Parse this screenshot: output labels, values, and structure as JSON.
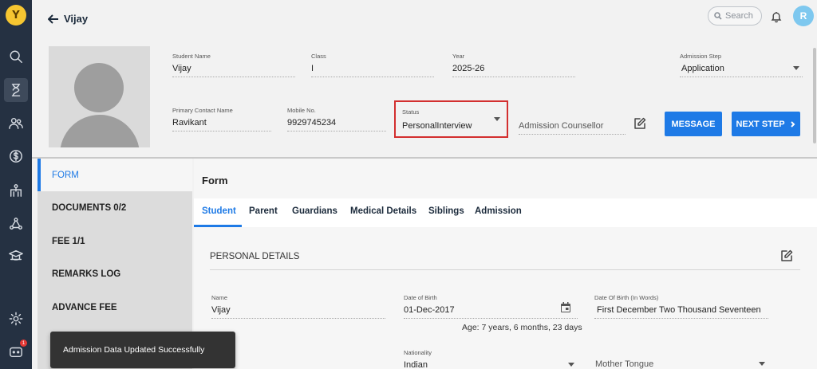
{
  "app": {
    "logo_letter": "Y"
  },
  "header": {
    "back_title": "Vijay",
    "search_placeholder": "Search",
    "avatar_initial": "R"
  },
  "student": {
    "student_name_label": "Student Name",
    "student_name": "Vijay",
    "class_label": "Class",
    "class_value": "I",
    "year_label": "Year",
    "year_value": "2025-26",
    "admission_step_label": "Admission Step",
    "admission_step_value": "Application",
    "primary_contact_label": "Primary Contact Name",
    "primary_contact_value": "Ravikant",
    "mobile_label": "Mobile No.",
    "mobile_value": "9929745234",
    "status_label": "Status",
    "status_value": "PersonalInterview",
    "counsellor_placeholder": "Admission Counsellor",
    "message_button": "MESSAGE",
    "next_step_button": "NEXT STEP"
  },
  "left_nav": {
    "items": [
      {
        "label": "FORM"
      },
      {
        "label": "DOCUMENTS 0/2"
      },
      {
        "label": "FEE 1/1"
      },
      {
        "label": "REMARKS LOG"
      },
      {
        "label": "ADVANCE FEE"
      }
    ]
  },
  "form": {
    "title": "Form",
    "tabs": [
      {
        "label": "Student"
      },
      {
        "label": "Parent"
      },
      {
        "label": "Guardians"
      },
      {
        "label": "Medical Details"
      },
      {
        "label": "Siblings"
      },
      {
        "label": "Admission"
      }
    ],
    "section_title": "PERSONAL DETAILS",
    "name_label": "Name",
    "name_value": "Vijay",
    "dob_label": "Date of Birth",
    "dob_value": "01-Dec-2017",
    "dob_words_label": "Date Of Birth (In Words)",
    "dob_words_value": "First December  Two Thousand Seventeen",
    "age_text": "Age: 7 years, 6 months, 23 days",
    "nationality_label": "Nationality",
    "nationality_value": "Indian",
    "mother_tongue_placeholder": "Mother Tongue"
  },
  "toast": {
    "message": "Admission Data Updated Successfully"
  },
  "colors": {
    "rail": "#253142",
    "accent": "#1e7ae6",
    "highlight_border": "#d32f2f"
  },
  "rail_badge": "1"
}
